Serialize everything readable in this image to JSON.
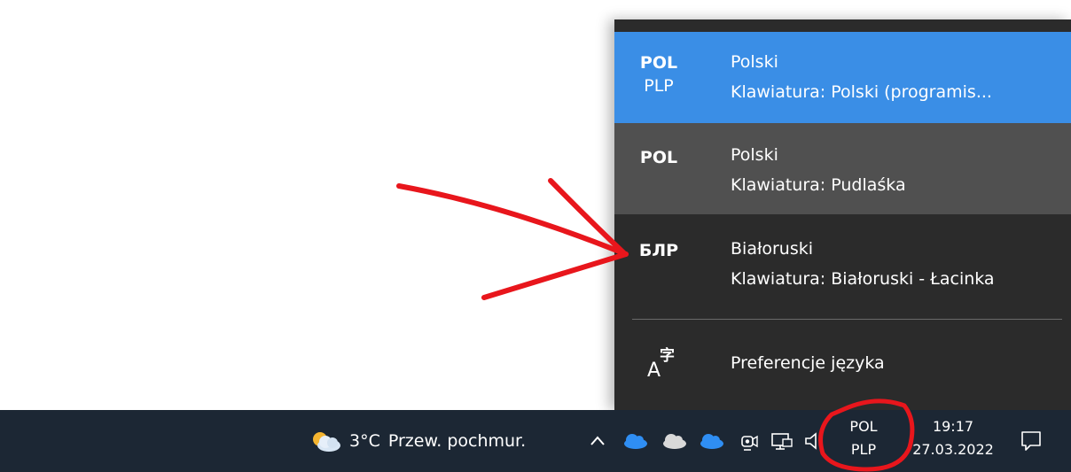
{
  "language_flyout": {
    "items": [
      {
        "code": "POL",
        "layout_code": "PLP",
        "language": "Polski",
        "keyboard": "Klawiatura: Polski (programis...",
        "state": "selected"
      },
      {
        "code": "POL",
        "layout_code": "",
        "language": "Polski",
        "keyboard": "Klawiatura: Pudlaśka",
        "state": "hover"
      },
      {
        "code": "БЛР",
        "layout_code": "",
        "language": "Białoruski",
        "keyboard": "Klawiatura: Białoruski - Łacinka",
        "state": "normal"
      }
    ],
    "preferences_label": "Preferencje języka",
    "preferences_icon": "language-preferences-icon"
  },
  "taskbar": {
    "weather": {
      "temperature": "3°C",
      "condition": "Przew. pochmur.",
      "icon": "partly-cloudy-icon"
    },
    "tray_icons": [
      "chevron-up-icon",
      "onedrive-icon",
      "onedrive-icon",
      "onedrive-icon",
      "meet-now-icon",
      "network-icon",
      "volume-icon"
    ],
    "input_indicator": {
      "language": "POL",
      "layout": "PLP"
    },
    "clock": {
      "time": "19:17",
      "date": "27.03.2022"
    },
    "notification_icon": "action-center-icon"
  },
  "colors": {
    "flyout_bg": "#2b2b2b",
    "selected_bg": "#3a8ee6",
    "hover_bg": "#505050",
    "taskbar_bg": "#1c2734",
    "annotation": "#e8161c"
  }
}
